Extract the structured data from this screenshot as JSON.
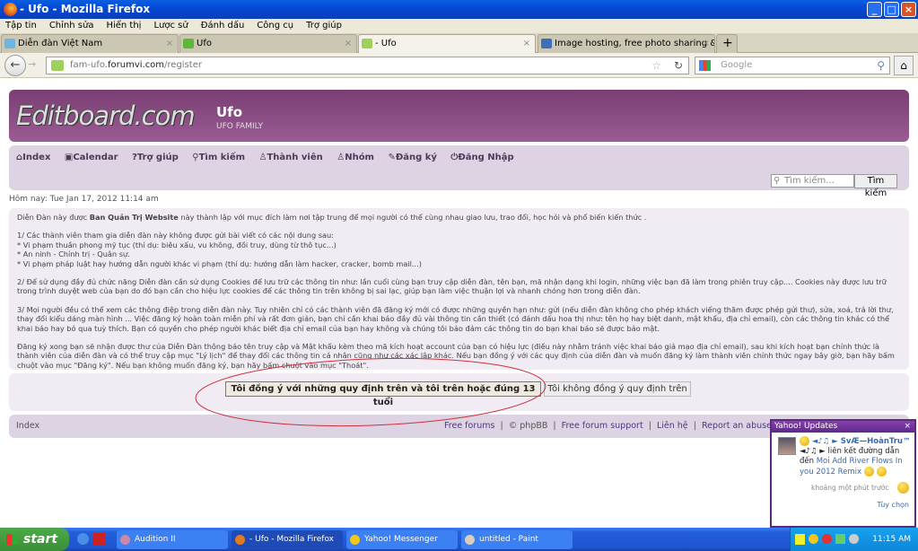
{
  "window": {
    "title": "- Ufo - Mozilla Firefox"
  },
  "menu": [
    "Tập tin",
    "Chỉnh sửa",
    "Hiển thị",
    "Lược sử",
    "Đánh dấu",
    "Công cụ",
    "Trợ giúp"
  ],
  "tabs": [
    {
      "label": "Diễn đàn Việt Nam"
    },
    {
      "label": "Ufo"
    },
    {
      "label": "- Ufo"
    },
    {
      "label": "Image hosting, free photo sharing & vide..."
    }
  ],
  "url": {
    "prefix": "fam-ufo.",
    "domain": "forumvi.com",
    "path": "/register"
  },
  "browser_search": {
    "placeholder": "Google"
  },
  "header": {
    "logo": "Editboard.com",
    "site_name": "Ufo",
    "site_desc": "UFO FAMILY"
  },
  "nav": [
    {
      "label": "Index",
      "icon": "home-icon"
    },
    {
      "label": "Calendar",
      "icon": "calendar-icon"
    },
    {
      "label": "Trợ giúp",
      "icon": "help-icon"
    },
    {
      "label": "Tìm kiếm",
      "icon": "search-icon"
    },
    {
      "label": "Thành viên",
      "icon": "user-icon"
    },
    {
      "label": "Nhóm",
      "icon": "group-icon"
    },
    {
      "label": "Đăng ký",
      "icon": "register-icon"
    },
    {
      "label": "Đăng Nhập",
      "icon": "power-icon"
    }
  ],
  "forum_search": {
    "placeholder": "Tìm kiếm...",
    "button": "Tìm kiếm"
  },
  "today": "Hôm nay: Tue Jan 17, 2012 11:14 am",
  "rules": {
    "intro_a": "Diễn Đàn này được ",
    "intro_bold": "Ban Quản Trị Website",
    "intro_b": " này thành lập với mục đích làm nơi tập trung để mọi người có thể cùng nhau giao lưu, trao đổi, học hỏi và phổ biến kiến thức .",
    "p1": [
      "1/ Các thành viên tham gia diễn đàn này không được gửi bài viết có các nội dung sau:",
      "* Vi phạm thuần phong mỹ tục (thí dụ: biêu xấu, vu không, đồi truy, dùng từ thô tục...)",
      "* An ninh - Chính trị - Quân sự.",
      "* Vi phạm pháp luật hay hướng dẫn người khác vi phạm (thí dụ: hướng dẫn làm hacker, cracker, bomb mail...)"
    ],
    "p2": "2/ Để sử dụng đầy đủ chức năng Diễn đàn cần sử dụng Cookies để lưu trữ các thông tin như: lần cuối cùng bạn truy cập diễn đàn, tên bạn, mã nhận dạng khi login, những việc bạn đã làm trong phiên truy cập.... Cookies này được lưu trữ trong trình duyệt web của bạn do đó bạn cần cho hiệu lực cookies để các thông tin trên không bị sai lạc, giúp bạn làm việc thuận lợi và nhanh chóng hơn trong diễn đàn.",
    "p3": "3/ Mọi người đều có thể xem các thông điệp trong diễn đàn này. Tuy nhiên chỉ có các thành viên đã đăng ký mới có được những quyền hạn như: gửi (nếu diễn đàn không cho phép khách viếng thăm được phép gửi thư), sửa, xoá, trả lời thư, thay đổi kiểu dáng màn hình ... Việc đăng ký hoàn toàn miễn phí và rất đơn giản, bạn chỉ cần khai báo đầy đủ vài thông tin cần thiết (có đánh dấu hoa thị như: tên họ hay biệt danh, mật khẩu, địa chỉ email), còn các thông tin khác có thể khai báo hay bỏ qua tuỳ thích. Bạn có quyền cho phép người khác biết địa chỉ email của bạn hay không và chúng tôi bảo đảm các thông tin do bạn khai báo sẽ được bảo mật.",
    "p4": "Đăng ký xong bạn sẽ nhận được thư của Diễn Đàn thông báo tên truy cập và Mật khẩu kèm theo mã kích hoạt account của bạn có hiệu lực (điều này nhằm tránh việc khai báo giả mạo địa chỉ email), sau khi kích hoạt bạn chính thức là thành viên của diễn đàn và có thể truy cập mục \"Lý lịch\" để thay đổi các thông tin cá nhân cũng như các xác lập khác. Nếu bạn đồng ý với các quy định của diễn đàn và muốn đăng ký làm thành viên chính thức ngay bây giờ, bạn hãy bấm chuột vào mục \"Đăng ký\". Nếu bạn không muốn đăng ký, bạn hãy bấm chuột vào mục \"Thoát\"."
  },
  "buttons": {
    "agree": "Tôi đồng ý với những quy định trên và tôi trên hoặc đúng 13 tuổi",
    "disagree": "Tôi không đồng ý quy định trên"
  },
  "footer": {
    "index": "Index",
    "links": [
      "Free forums",
      "©  phpBB",
      "Free forum support",
      "Liên hệ",
      "Report an abuse"
    ]
  },
  "yahoo": {
    "title": "Yahoo! Updates",
    "user": "◄♪♫ ► SvÆ—HoànTru™",
    "line2": "◄♪♫ ► liên kết đường dẫn",
    "line3": "đến",
    "link": "Moi Add River Flows In you 2012 Remix",
    "time": "khoảng một phút trước",
    "options": "Tùy chọn"
  },
  "taskbar": {
    "start": "start",
    "items": [
      "Audition II",
      "- Ufo - Mozilla Firefox",
      "Yahoo! Messenger",
      "untitled - Paint"
    ],
    "clock": "11:15 AM"
  },
  "colors": {
    "header": "#8a4c83",
    "nav": "#ddd3e3",
    "content": "#f1ecf3",
    "annotation": "#d0303a"
  }
}
